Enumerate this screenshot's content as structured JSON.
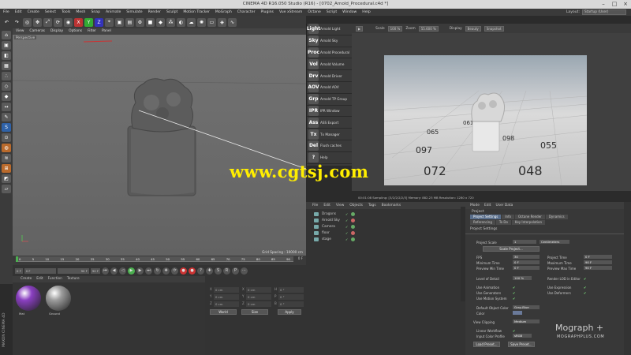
{
  "window": {
    "title": "CINEMA 4D R16.050 Studio (R16) - [0702_Arnold_Procedural.c4d *]",
    "controls": [
      "–",
      "□",
      "×"
    ]
  },
  "menu": [
    "File",
    "Edit",
    "Create",
    "Select",
    "Tools",
    "Mesh",
    "Snap",
    "Animate",
    "Simulate",
    "Render",
    "Sculpt",
    "Motion Tracker",
    "MoGraph",
    "Character",
    "Plugins",
    "Vue xStream",
    "Octane",
    "Script",
    "Window",
    "Help"
  ],
  "layout": {
    "label": "Layout:",
    "value": "Startup (User)"
  },
  "toolbar_icons": [
    "undo-icon",
    "redo-icon",
    "live-select-icon",
    "move-icon",
    "scale-icon",
    "rotate-icon",
    "recent-tool-icon",
    "x-axis-icon",
    "y-axis-icon",
    "z-axis-icon",
    "coordinate-system-icon",
    "render-view-icon",
    "render-picture-viewer-icon",
    "render-settings-icon",
    "cube-icon",
    "subdivision-icon",
    "array-icon",
    "camera-icon",
    "scene-icon",
    "light-icon",
    "floor-icon",
    "deformer-icon",
    "spline-icon"
  ],
  "viewport": {
    "menu": [
      "View",
      "Cameras",
      "Display",
      "Options",
      "Filter",
      "Panel"
    ],
    "label": "Perspective",
    "grid_spacing": "Grid Spacing : 10000 cm"
  },
  "arnold_menu": [
    {
      "icon": "Light",
      "label": "Arnold Light"
    },
    {
      "icon": "Sky",
      "label": "Arnold Sky"
    },
    {
      "icon": "Proc",
      "label": "Arnold Procedural"
    },
    {
      "icon": "Vol",
      "label": "Arnold Volume"
    },
    {
      "icon": "Drv",
      "label": "Arnold Driver"
    },
    {
      "icon": "AOV",
      "label": "Arnold AOV"
    },
    {
      "icon": "Grp",
      "label": "Arnold TP Group"
    },
    {
      "icon": "IPR",
      "label": "IPR Window"
    },
    {
      "icon": "Ass",
      "label": "ASS Export"
    },
    {
      "icon": "Tx",
      "label": "Tx Manager"
    },
    {
      "icon": "Del",
      "label": "Flush caches"
    },
    {
      "icon": "?",
      "label": "Help"
    }
  ],
  "render_view": {
    "scale_label": "Scale",
    "scale_value": "100 %",
    "zoom_label": "Zoom",
    "zoom_value": "55.600 %",
    "display_label": "Display",
    "display_value": "Beauty",
    "snapshot": "Snapshot",
    "floor_numbers": [
      "072",
      "097",
      "048",
      "055",
      "065",
      "061",
      "098"
    ],
    "status": "00:01:08   Sampling: [3/2/2/2/2/3]   Memory: 882.23 MB   Resolution: 1280 x 720"
  },
  "watermark": "www.cgtsj.com",
  "timeline": {
    "ticks": [
      "0",
      "5",
      "10",
      "15",
      "20",
      "25",
      "30",
      "35",
      "40",
      "45",
      "50",
      "55",
      "60",
      "65",
      "70",
      "75",
      "80",
      "85",
      "90"
    ],
    "current": "0 F",
    "start": "0 F",
    "min": "0 F",
    "max": "90 F",
    "end": "90 F"
  },
  "material_manager": {
    "menu": [
      "Create",
      "Edit",
      "Function",
      "Texture"
    ],
    "materials": [
      {
        "name": "Mat",
        "color": "#8a3fc1"
      },
      {
        "name": "Ground",
        "color": "#9c9c9c"
      }
    ]
  },
  "coordinates": {
    "fields": [
      [
        "X",
        "0 cm",
        "X",
        "0 cm",
        "H",
        "0 °"
      ],
      [
        "Y",
        "0 cm",
        "Y",
        "0 cm",
        "P",
        "0 °"
      ],
      [
        "Z",
        "0 cm",
        "Z",
        "0 cm",
        "B",
        "0 °"
      ]
    ],
    "mode_1": "World",
    "mode_2": "Size",
    "apply": "Apply"
  },
  "objects": {
    "menu": [
      "File",
      "Edit",
      "View",
      "Objects",
      "Tags",
      "Bookmarks"
    ],
    "rows": [
      "Dragons",
      "Arnold Sky",
      "Camera",
      "floor",
      "stage"
    ]
  },
  "attributes": {
    "menu": [
      "Mode",
      "Edit",
      "User Data"
    ],
    "heading": "Project",
    "tabs_row1": [
      "Project Settings",
      "Info",
      "Octane Render",
      "Dynamics"
    ],
    "tabs_row2": [
      "Referencing",
      "To Do",
      "Key Interpolation"
    ],
    "section": "Project Settings",
    "project_scale_label": "Project Scale",
    "project_scale_value": "1",
    "project_scale_unit": "Centimeters",
    "scale_project_btn": "Scale Project...",
    "fps_label": "FPS",
    "fps_value": "30",
    "project_time_label": "Project Time",
    "project_time_value": "0 F",
    "min_time_label": "Minimum Time",
    "min_time_value": "0 F",
    "max_time_label": "Maximum Time",
    "max_time_value": "90 F",
    "prev_min_label": "Preview Min Time",
    "prev_min_value": "0 F",
    "prev_max_label": "Preview Max Time",
    "prev_max_value": "90 F",
    "lod_label": "Level of Detail",
    "lod_value": "100 %",
    "render_lod_label": "Render LOD in Editor",
    "use_animation": "Use Animation",
    "use_expression": "Use Expression",
    "use_generators": "Use Generators",
    "use_deformers": "Use Deformers",
    "use_motion": "Use Motion System",
    "default_color_label": "Default Object Color",
    "default_color_value": "Gray-Blue",
    "color_label": "Color",
    "view_clipping_label": "View Clipping",
    "view_clipping_value": "Medium",
    "linear_workflow": "Linear Workflow",
    "input_color_label": "Input Color Profile",
    "input_color_value": "sRGB",
    "load_preset": "Load Preset...",
    "save_preset": "Save Preset..."
  },
  "brand": {
    "mograph": "Mograph +",
    "mograph_url": "MOGRAPHPLUS.COM",
    "maxon": "MAXON CINEMA 4D"
  }
}
